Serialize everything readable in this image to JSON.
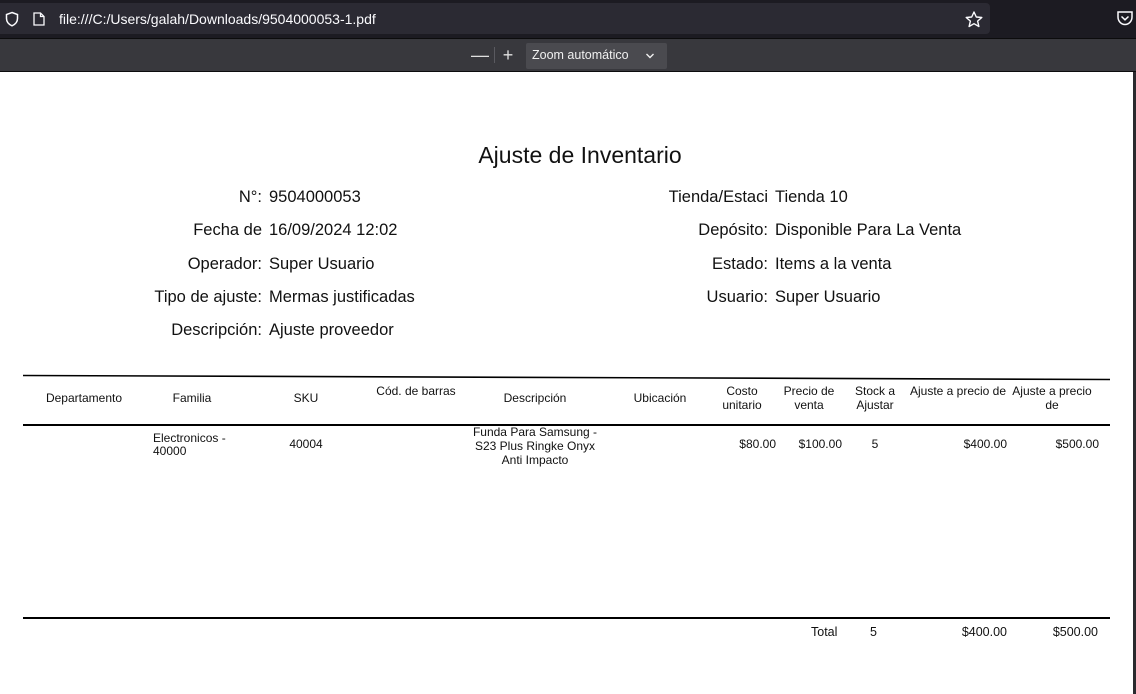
{
  "browser": {
    "url": "file:///C:/Users/galah/Downloads/9504000053-1.pdf",
    "zoom_out_label": "—",
    "zoom_in_label": "+",
    "zoom_level": "Zoom automático"
  },
  "document": {
    "title": "Ajuste de Inventario",
    "fields_left": [
      {
        "label": "N°:",
        "value": "9504000053"
      },
      {
        "label": "Fecha de",
        "value": "16/09/2024 12:02"
      },
      {
        "label": "Operador:",
        "value": "Super Usuario"
      },
      {
        "label": "Tipo de ajuste:",
        "value": "Mermas justificadas"
      },
      {
        "label": "Descripción:",
        "value": "Ajuste proveedor"
      }
    ],
    "fields_right": [
      {
        "label": "Tienda/Estaci",
        "value": "Tienda 10"
      },
      {
        "label": "Depósito:",
        "value": "Disponible Para La Venta"
      },
      {
        "label": "Estado:",
        "value": "Items a la venta"
      },
      {
        "label": "Usuario:",
        "value": "Super Usuario"
      }
    ],
    "table": {
      "headers": [
        "Departamento",
        "Familia",
        "SKU",
        "Cód. de barras",
        "Descripción",
        "Ubicación",
        "Costo unitario",
        "Precio de venta",
        "Stock a Ajustar",
        "Ajuste a precio de",
        "Ajuste a precio de"
      ],
      "rows": [
        {
          "departamento": "",
          "familia": "Electronicos - 40000",
          "sku": "40004",
          "cod_barras": "",
          "descripcion": "Funda Para Samsung - S23 Plus Ringke Onyx Anti Impacto",
          "ubicacion": "",
          "costo_unitario": "$80.00",
          "precio_venta": "$100.00",
          "stock_ajustar": "5",
          "ajuste_costo": "$400.00",
          "ajuste_venta": "$500.00"
        }
      ],
      "totals": {
        "label": "Total",
        "stock": "5",
        "ajuste_costo": "$400.00",
        "ajuste_venta": "$500.00"
      }
    }
  }
}
